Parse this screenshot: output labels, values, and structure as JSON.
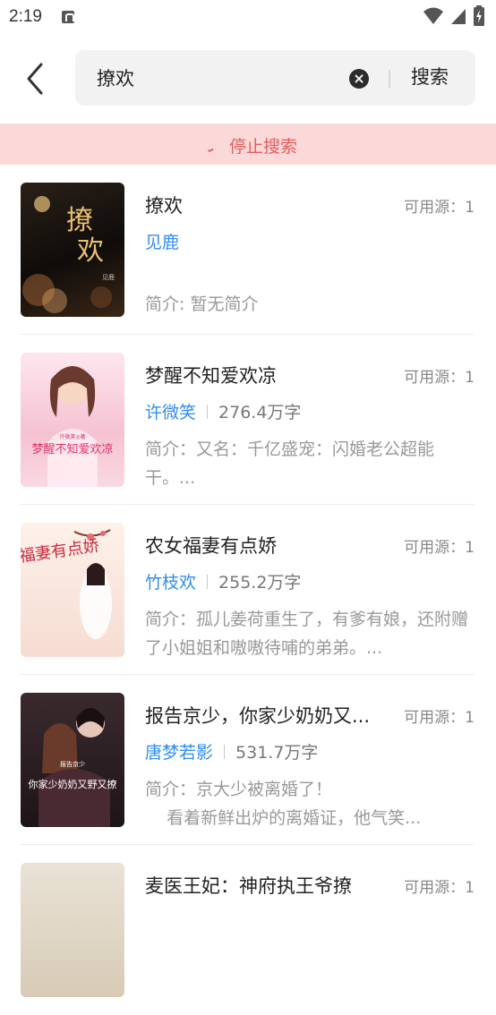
{
  "status_bar": {
    "time": "2:19"
  },
  "search": {
    "query": "撩欢",
    "submit_label": "搜索"
  },
  "stop_search_label": "停止搜索",
  "books": [
    {
      "title": "撩欢",
      "author": "见鹿",
      "word_count": "",
      "sources": "可用源：1",
      "intro": "简介: 暂无简介",
      "cover_title": "撩欢",
      "cover_author": "见鹿",
      "cover_colors": [
        "#1a1410",
        "#3b2a1c"
      ]
    },
    {
      "title": "梦醒不知爱欢凉",
      "author": "许微笑",
      "word_count": "276.4万字",
      "sources": "可用源：1",
      "intro": "简介：又名：千亿盛宠：闪婚老公超能干。...",
      "cover_title": "梦醒不知爱欢凉",
      "cover_author": "许微笑◎著",
      "cover_colors": [
        "#fde3ea",
        "#f3b6c8"
      ]
    },
    {
      "title": "农女福妻有点娇",
      "author": "竹枝欢",
      "word_count": "255.2万字",
      "sources": "可用源：1",
      "intro": "简介：孤儿姜荷重生了，有爹有娘，还附赠了小姐姐和嗷嗷待哺的弟弟。...",
      "cover_title": "农女福妻有点娇",
      "cover_author": "",
      "cover_colors": [
        "#fbeee8",
        "#f4d4cc"
      ]
    },
    {
      "title": "报告京少，你家少奶奶又...",
      "author": "唐梦若影",
      "word_count": "531.7万字",
      "sources": "可用源：1",
      "intro": "简介：京大少被离婚了！\n    看着新鲜出炉的离婚证，他气笑...",
      "cover_title": "你家少奶奶又野又撩",
      "cover_author": "报告京少",
      "cover_colors": [
        "#2a1e24",
        "#5a2f3a"
      ]
    },
    {
      "title": "麦医王妃：神府执王爷撩",
      "author": "",
      "word_count": "",
      "sources": "可用源：1",
      "intro": "",
      "cover_title": "",
      "cover_author": "",
      "cover_colors": [
        "#e9e2d6",
        "#d8cbb6"
      ]
    }
  ],
  "colors": {
    "accent": "#2f8cf0",
    "stop": "#e15e5e",
    "stop_bg": "#fbd9d9"
  }
}
